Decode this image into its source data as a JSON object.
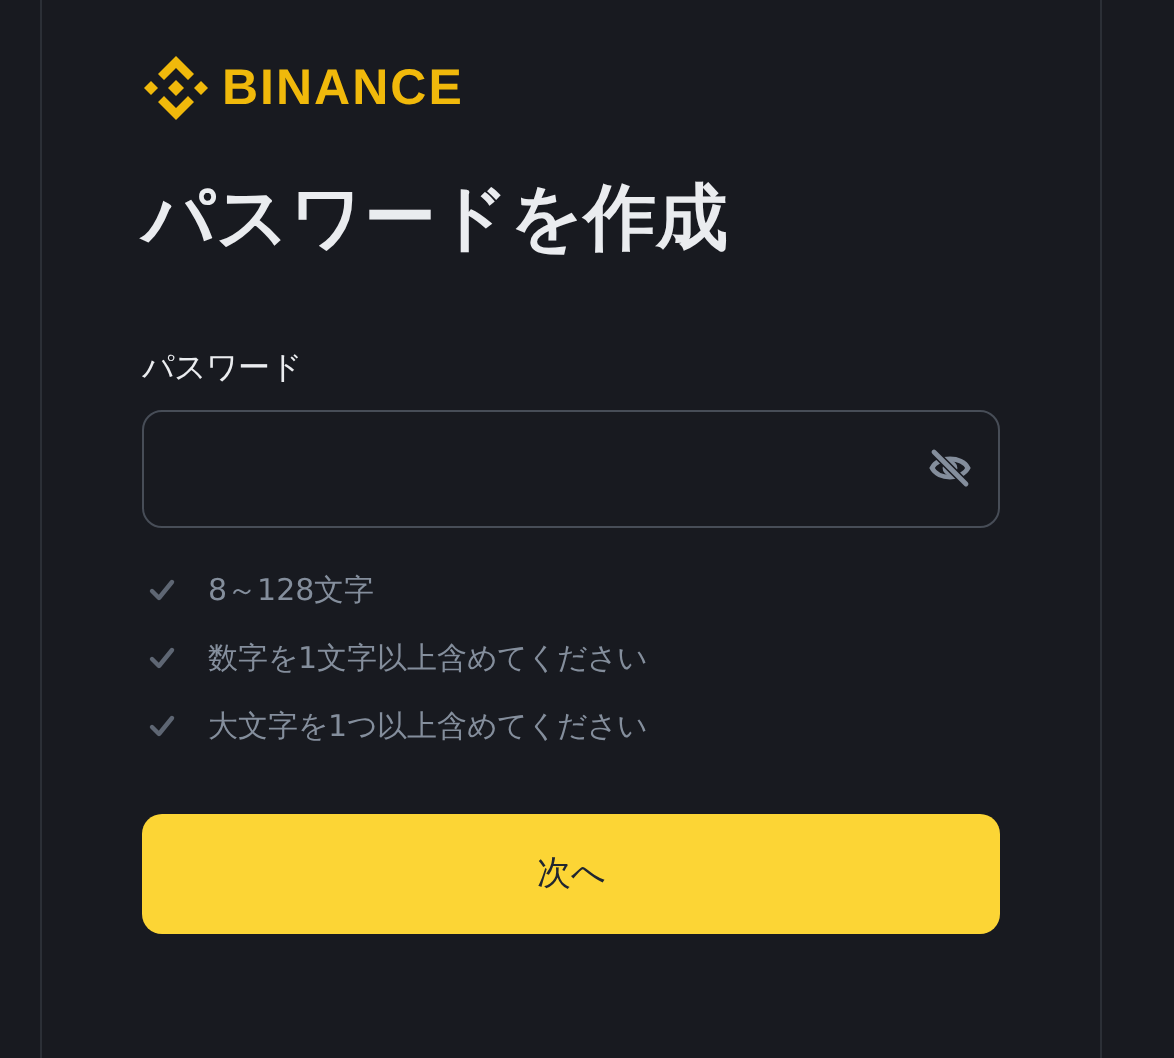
{
  "logo": {
    "text": "BINANCE"
  },
  "title": "パスワードを作成",
  "password_field": {
    "label": "パスワード",
    "password_visible": false
  },
  "rules": [
    {
      "text": "8～128文字",
      "met": false
    },
    {
      "text": "数字を1文字以上含めてください",
      "met": false
    },
    {
      "text": "大文字を1つ以上含めてください",
      "met": false
    }
  ],
  "next_button": "次へ"
}
